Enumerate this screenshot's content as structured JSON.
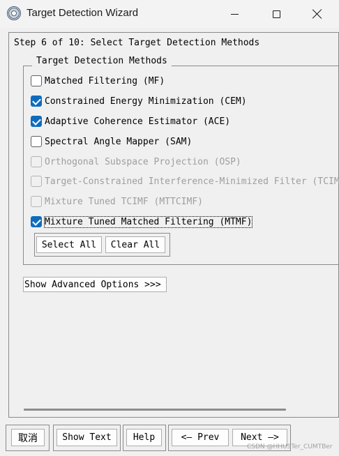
{
  "window": {
    "title": "Target Detection Wizard",
    "icon": "envi-app-icon"
  },
  "step": {
    "label": "Step 6 of 10: Select Target Detection Methods"
  },
  "methods_group": {
    "legend": "Target Detection Methods",
    "options": [
      {
        "label": "Matched Filtering (MF)",
        "checked": false,
        "enabled": true
      },
      {
        "label": "Constrained Energy Minimization (CEM)",
        "checked": true,
        "enabled": true
      },
      {
        "label": "Adaptive Coherence Estimator (ACE)",
        "checked": true,
        "enabled": true
      },
      {
        "label": "Spectral Angle Mapper (SAM)",
        "checked": false,
        "enabled": true
      },
      {
        "label": "Orthogonal Subspace Projection (OSP)",
        "checked": false,
        "enabled": false
      },
      {
        "label": "Target-Constrained Interference-Minimized Filter (TCIMF",
        "checked": false,
        "enabled": false
      },
      {
        "label": "Mixture Tuned TCIMF (MTTCIMF)",
        "checked": false,
        "enabled": false
      },
      {
        "label": "Mixture Tuned Matched Filtering (MTMF)",
        "checked": true,
        "enabled": true,
        "focused": true
      }
    ],
    "select_all": "Select All",
    "clear_all": "Clear All"
  },
  "advanced": {
    "label": "Show Advanced Options >>>"
  },
  "footer": {
    "cancel": "取消",
    "show_text": "Show Text",
    "help": "Help",
    "prev": "<— Prev",
    "next": "Next —>"
  },
  "watermark": "CSDN @HHUSTer_CUMTBer",
  "colors": {
    "checkbox_checked": "#0f6cbd",
    "background": "#f0f0f0"
  }
}
